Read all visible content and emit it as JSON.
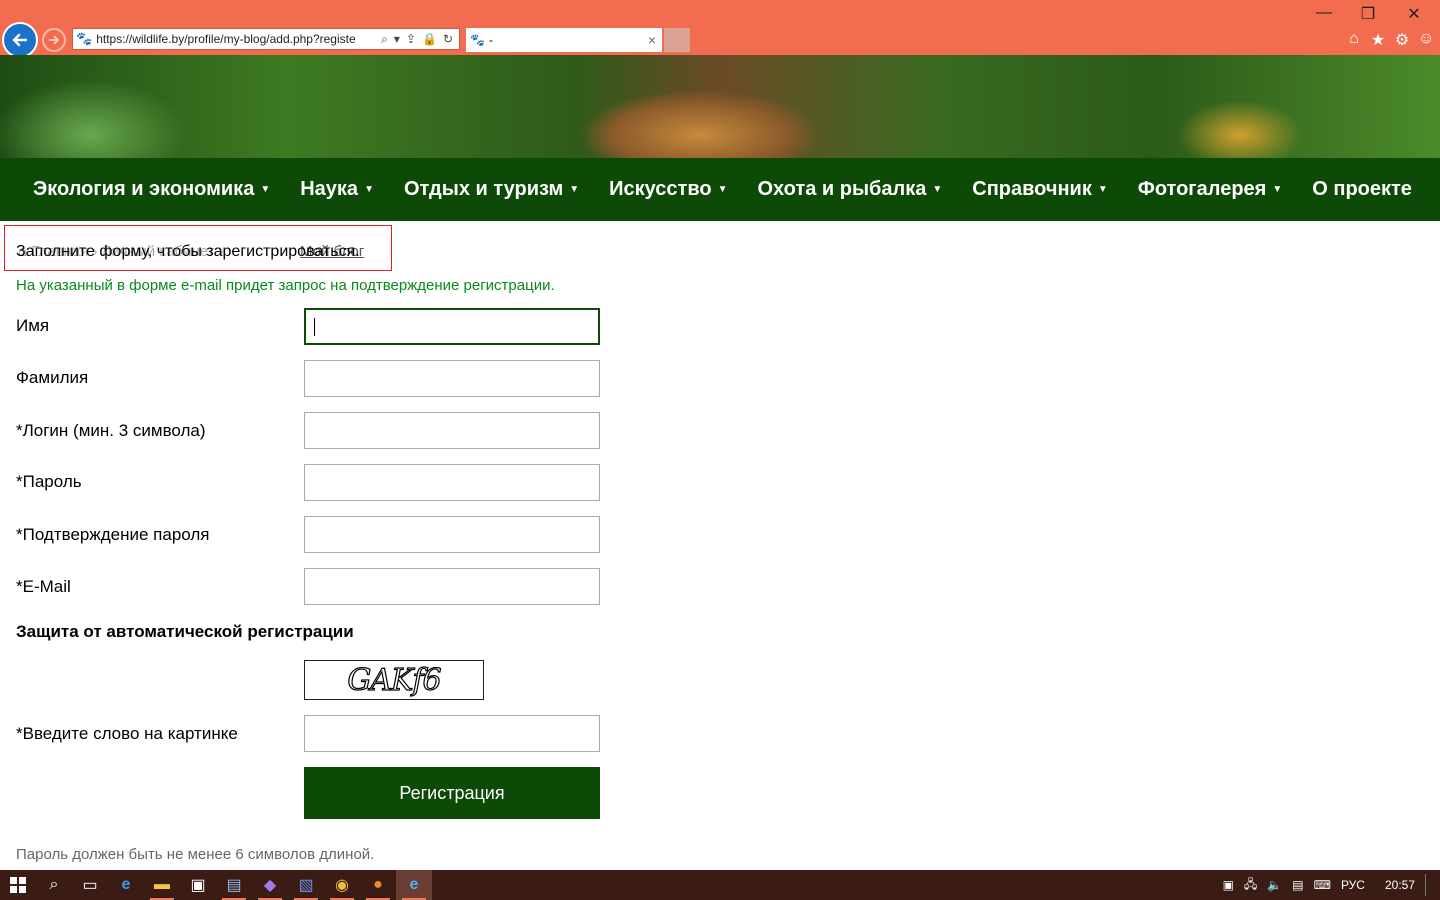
{
  "browser": {
    "url": "https://wildlife.by/profile/my-blog/add.php?registe",
    "tab_title": "-",
    "tab_close": "×",
    "window_controls": [
      "—",
      "❐",
      "✕"
    ],
    "toolbar_icons": [
      "home-icon",
      "favorites-star-icon",
      "settings-gear-icon",
      "smiley-feedback-icon"
    ]
  },
  "nav": {
    "items": [
      {
        "label": "Экология и экономика",
        "dropdown": true
      },
      {
        "label": "Наука",
        "dropdown": true
      },
      {
        "label": "Отдых и туризм",
        "dropdown": true
      },
      {
        "label": "Искусство",
        "dropdown": true
      },
      {
        "label": "Охота и рыбалка",
        "dropdown": true
      },
      {
        "label": "Справочник",
        "dropdown": true
      },
      {
        "label": "Фотогалерея",
        "dropdown": true
      },
      {
        "label": "О проекте",
        "dropdown": false
      }
    ]
  },
  "breadcrumb": {
    "home": "Главная",
    "separator": "›",
    "personal": "Личный кабинет",
    "current": "Мой блог"
  },
  "intro": "Заполните форму, чтобы зарегистрироваться.",
  "notice": "На указанный в форме e-mail придет запрос на подтверждение регистрации.",
  "form": {
    "fields": [
      {
        "label": "Имя",
        "value": ""
      },
      {
        "label": "Фамилия",
        "value": ""
      },
      {
        "label": "*Логин (мин. 3 символа)",
        "value": ""
      },
      {
        "label": "*Пароль",
        "value": ""
      },
      {
        "label": "*Подтверждение пароля",
        "value": ""
      },
      {
        "label": "*E-Mail",
        "value": ""
      }
    ],
    "protection_title": "Защита от автоматической регистрации",
    "captcha_text": "GAKf6",
    "captcha_label": "*Введите слово на картинке",
    "submit_label": "Регистрация",
    "password_note": "Пароль должен быть не менее 6 символов длиной."
  },
  "taskbar": {
    "language": "РУС",
    "time": "20:57"
  },
  "colors": {
    "chrome": "#f26c50",
    "nav_bg": "#0e4a07",
    "notice_text": "#0a8a1a",
    "highlight_border": "#e0202a",
    "taskbar": "#3a1c14"
  }
}
